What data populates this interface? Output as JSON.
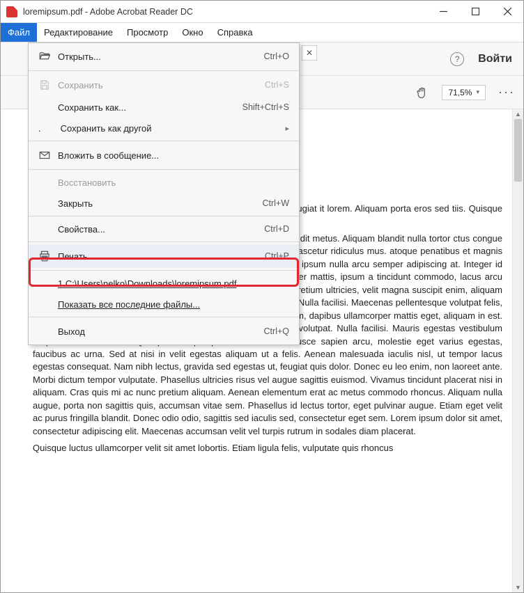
{
  "titlebar": {
    "text": "loremipsum.pdf - Adobe Acrobat Reader DC"
  },
  "menubar": {
    "items": [
      {
        "label": "Файл",
        "active": true
      },
      {
        "label": "Редактирование"
      },
      {
        "label": "Просмотр"
      },
      {
        "label": "Окно"
      },
      {
        "label": "Справка"
      }
    ]
  },
  "toolbar": {
    "help_glyph": "?",
    "signin_label": "Войти",
    "zoom_value": "71,5%",
    "dots": "···"
  },
  "file_menu": {
    "open": {
      "label": "Открыть...",
      "shortcut": "Ctrl+O"
    },
    "save": {
      "label": "Сохранить",
      "shortcut": "Ctrl+S",
      "disabled": true
    },
    "save_as": {
      "label": "Сохранить как...",
      "shortcut": "Shift+Ctrl+S"
    },
    "save_other": {
      "label": "Сохранить как другой"
    },
    "attach": {
      "label": "Вложить в сообщение..."
    },
    "restore": {
      "label": "Восстановить",
      "disabled": true
    },
    "close": {
      "label": "Закрыть",
      "shortcut": "Ctrl+W"
    },
    "properties": {
      "label": "Свойства...",
      "shortcut": "Ctrl+D"
    },
    "print": {
      "label": "Печать...",
      "shortcut": "Ctrl+P"
    },
    "recent1": {
      "label": "1 C:\\Users\\nelko\\Downloads\\loremipsum.pdf"
    },
    "show_recent": {
      "label": "Показать все последние файлы..."
    },
    "exit": {
      "label": "Выход",
      "shortcut": "Ctrl+Q"
    }
  },
  "document": {
    "p1": "illa est purus, ultrices in porttitor is. Curabitur eget diam id felis feugiat it lorem. Aliquam porta eros sed tiis. Quisque imperdiet ipsum vel lesuada vestibulum turpis viverra id.",
    "p2": "n blandit metus, ac posuere lorem e, vehicula eu dui. Duis lacinia dit metus. Aliquam blandit nulla tortor ctus congue porta. Vivamus viverra ris ligula, non faucibus nulla volutpat es, nascetur ridiculus mus. atoque penatibus et magnis dis parturient montes, nascetur ridiculus mus. Vestibulum magna ipsum nulla arcu semper adipiscing at. Integer id pellentesque orci. Curabitur viverra dui lorem neс rhoncus. Integer mattis, ipsum a tincidunt commodo, lacus arcu elementum elit, at mollis eros ante ac risus. In volutpat, ante at pretium ultricies, velit magna suscipit enim, aliquam blandit massa orci nec lorem. Nulla facilisi. Duis eu vehicula arcu. Nulla facilisi. Maecenas pellentesque volutpat felis, quis tristique ligula luctus vel. Sed nec mi eros. Integer augue enim, dapibus ullamcorper mattis eget, aliquam in est. Morbi sollicitudin libero nec augue dignissim ut consectetur dui volutpat. Nulla facilisi. Mauris egestas vestibulum neque cursus tincidunt. Quisque volutpat pharetra tincidunt. Fusce sapien arcu, molestie eget varius egestas, faucibus ac urna. Sed at nisi in velit egestas aliquam ut a felis. Aenean malesuada iaculis nisl, ut tempor lacus egestas consequat. Nam nibh lectus, gravida sed egestas ut, feugiat quis dolor. Donec eu leo enim, non laoreet ante. Morbi dictum tempor vulputate. Phasellus ultricies risus vel augue sagittis euismod. Vivamus tincidunt placerat nisi in aliquam. Cras quis mi ac nunc pretium aliquam. Aenean elementum erat ac metus commodo rhoncus. Aliquam nulla augue, porta non sagittis quis, accumsan vitae sem. Phasellus id lectus tortor, eget pulvinar augue. Etiam eget velit ac purus fringilla blandit. Donec odio odio, sagittis sed iaculis sed, consectetur eget sem. Lorem ipsum dolor sit amet, consectetur adipiscing elit. Maecenas accumsan velit vel turpis rutrum in sodales diam placerat.",
    "p3": "Quisque luctus ullamcorper velit sit amet lobortis. Etiam ligula felis, vulputate quis rhoncus"
  }
}
